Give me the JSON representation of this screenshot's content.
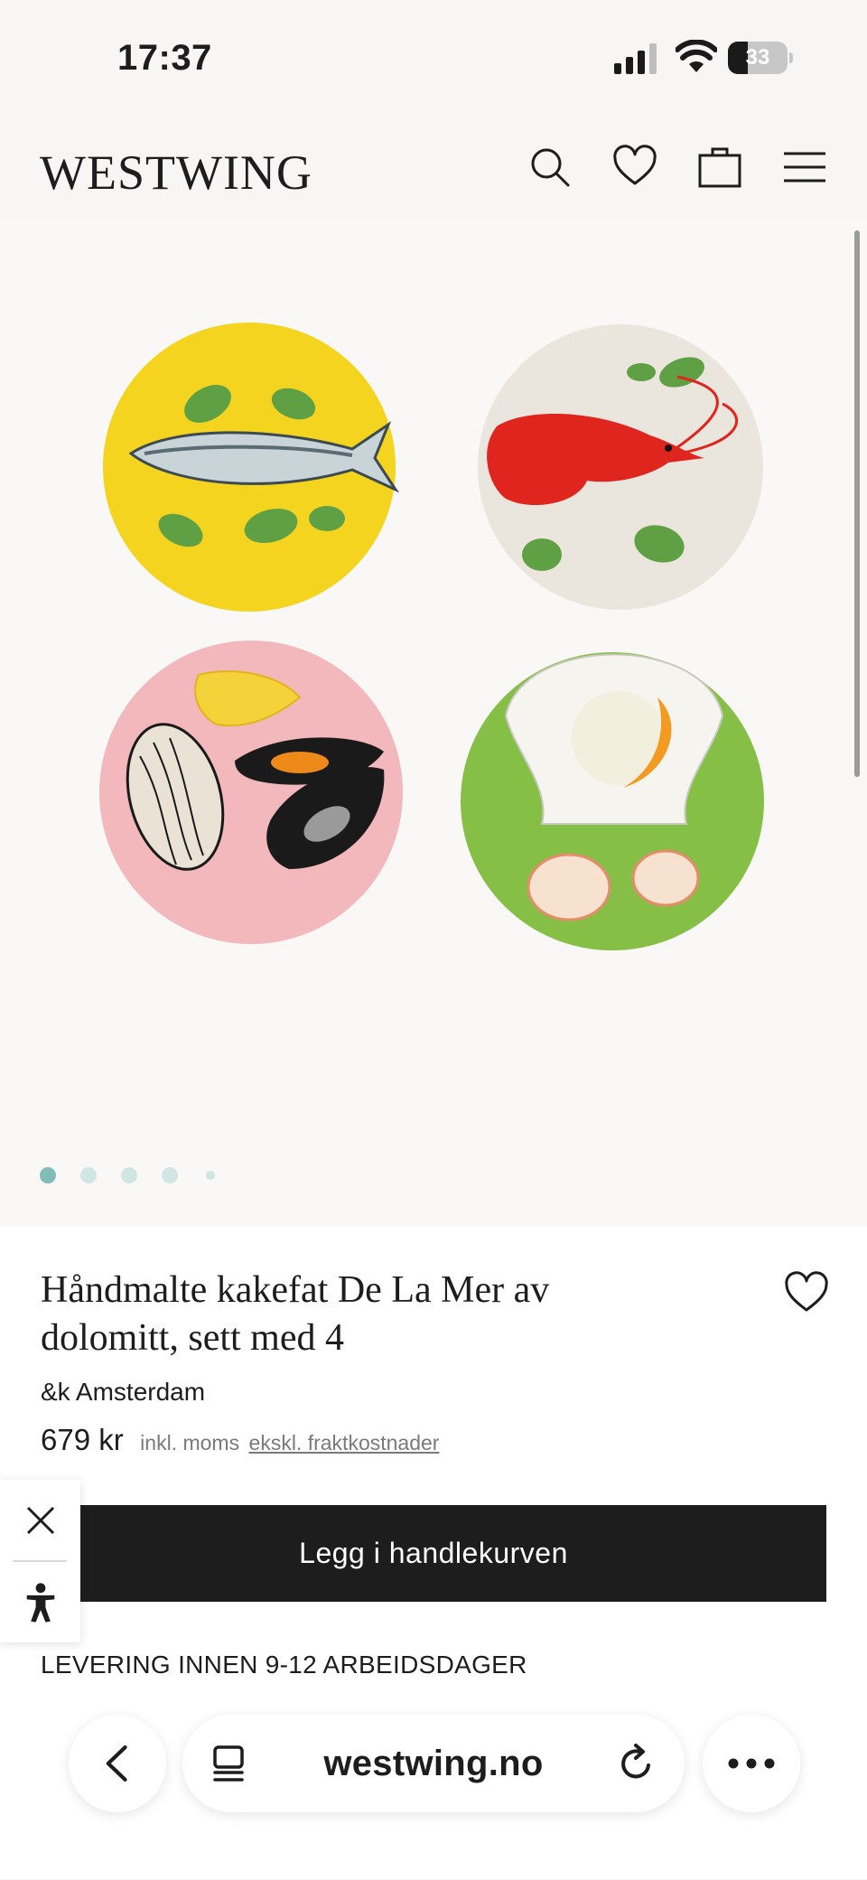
{
  "status_bar": {
    "time": "17:37",
    "battery_level": "33",
    "battery_fraction": 0.33,
    "icons": [
      "cellular-signal-icon",
      "wifi-icon",
      "battery-icon"
    ]
  },
  "header": {
    "logo": "WESTWING",
    "icons": [
      "search-icon",
      "heart-icon",
      "bag-icon",
      "menu-icon"
    ]
  },
  "gallery": {
    "plates": [
      {
        "name": "sardine-plate",
        "color": "#f4d41f"
      },
      {
        "name": "shrimp-plate",
        "color": "#ebe6dd"
      },
      {
        "name": "mussel-plate",
        "color": "#f2b8bb"
      },
      {
        "name": "scallop-plate",
        "color": "#86bf45"
      }
    ],
    "active_slide": 1,
    "slide_count": 5
  },
  "product": {
    "title_line1": "Håndmalte kakefat De La Mer av",
    "title_line2": "dolomitt, sett med 4",
    "brand": "&k Amsterdam",
    "price": "679 kr",
    "vat_note": "inkl. moms",
    "shipping_note": "ekskl. fraktkostnader",
    "add_to_cart": "Legg i handlekurven",
    "delivery": "LEVERING INNEN 9-12 ARBEIDSDAGER"
  },
  "browser": {
    "url": "westwing.no",
    "icons": [
      "back-chevron-icon",
      "tabs-icon",
      "reload-icon",
      "more-icon"
    ]
  },
  "colors": {
    "accent": "#1d1d1d",
    "dot_active": "#7fbdb5",
    "dot_inactive": "#cfe6e2"
  }
}
